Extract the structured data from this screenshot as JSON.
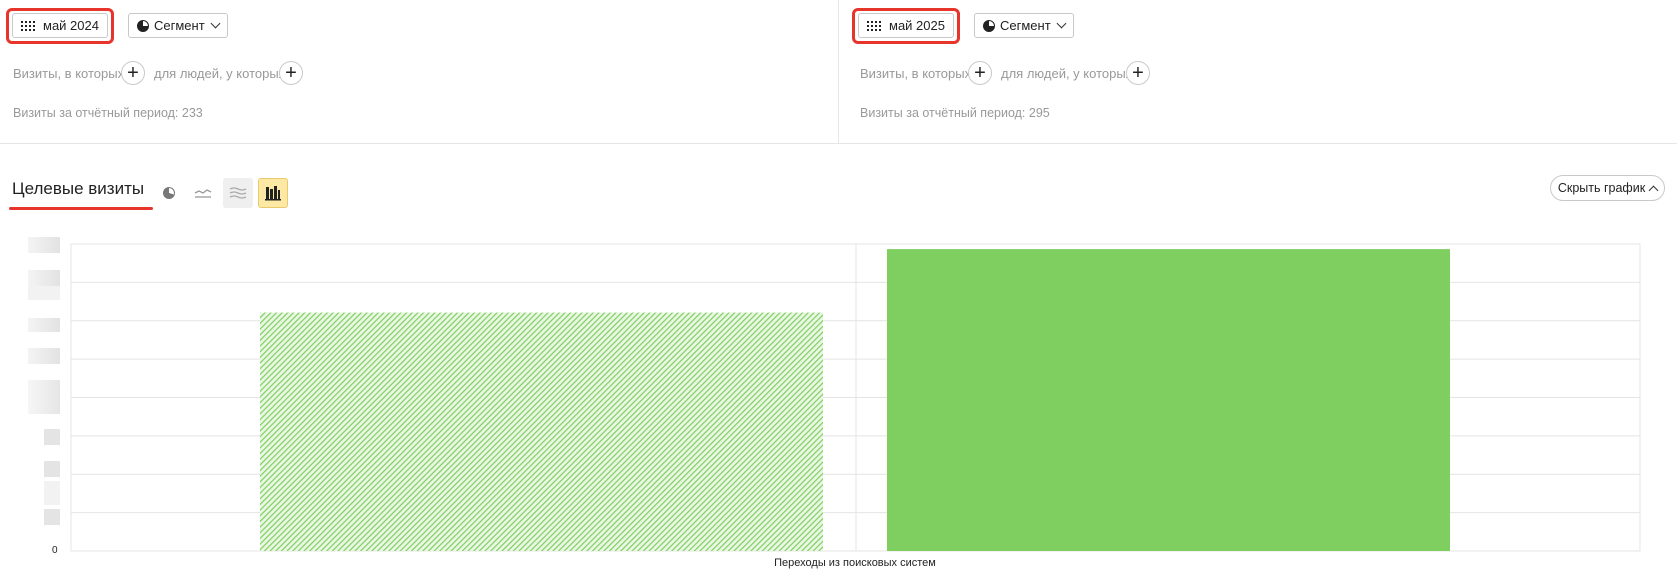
{
  "left_panel": {
    "date_label": "май 2024",
    "segment_label": "Сегмент",
    "filter_visits_label": "Визиты, в которых",
    "filter_people_label": "для людей, у которых",
    "visits_summary": "Визиты за отчётный период: 233"
  },
  "right_panel": {
    "date_label": "май 2025",
    "segment_label": "Сегмент",
    "filter_visits_label": "Визиты, в которых",
    "filter_people_label": "для людей, у которых",
    "visits_summary": "Визиты за отчётный период: 295"
  },
  "chart_section": {
    "title": "Целевые визиты",
    "hide_chart_label": "Скрыть график",
    "view_modes": [
      "pie",
      "line",
      "area",
      "bar"
    ],
    "active_view": "bar"
  },
  "icons": {
    "calendar": "calendar-icon",
    "segment": "pie-chart-icon",
    "chevron": "chevron-down-icon",
    "add": "plus-icon",
    "hide": "chevron-up-icon"
  },
  "colors": {
    "bar_color": "#7ecf5f",
    "highlight": "#e8352c",
    "active_view_bg": "#fde9a3"
  },
  "chart_data": {
    "type": "bar",
    "categories": [
      "Переходы из поисковых систем"
    ],
    "series": [
      {
        "period": "май 2024",
        "values": [
          233
        ],
        "pattern": "hatched"
      },
      {
        "period": "май 2025",
        "values": [
          295
        ],
        "pattern": "solid"
      }
    ],
    "ylim": [
      0,
      300
    ],
    "y_tick_labels": [
      "0"
    ],
    "grid": true
  }
}
